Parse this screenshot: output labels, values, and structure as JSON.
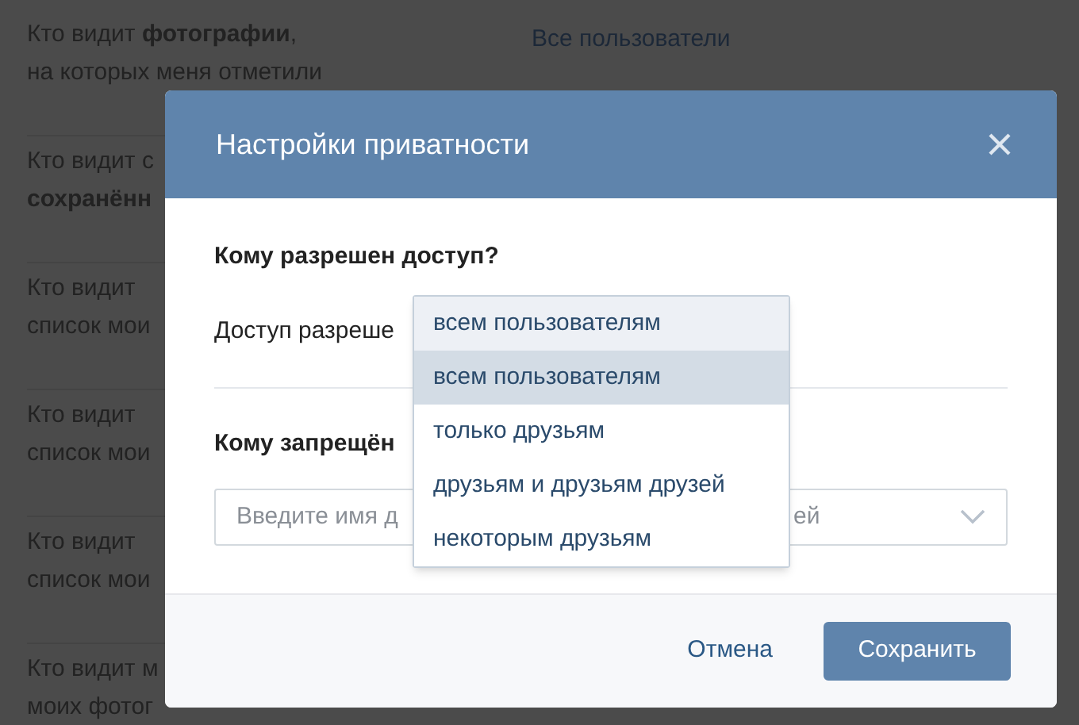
{
  "background": {
    "rows": [
      {
        "label": "Кто видит **фотографии**,\nна которых меня отметили",
        "value": "Все пользователи"
      },
      {
        "label": "Кто видит с\n**сохранённ**"
      },
      {
        "label": "Кто видит\nсписок мои"
      },
      {
        "label": "Кто видит\nсписок мои"
      },
      {
        "label": "Кто видит\nсписок мои"
      },
      {
        "label": "Кто видит м\nмоих фотог"
      }
    ]
  },
  "modal": {
    "title": "Настройки приватности",
    "allow_heading": "Кому разрешен доступ?",
    "allow_label": "Доступ разреше",
    "dropdown": {
      "value": "всем пользователям",
      "expanded": true,
      "options": [
        {
          "label": "всем пользователям",
          "selected": true
        },
        {
          "label": "только друзьям",
          "selected": false
        },
        {
          "label": "друзьям и друзьям друзей",
          "selected": false
        },
        {
          "label": "некоторым друзьям",
          "selected": false
        }
      ]
    },
    "deny_heading": "Кому запрещён",
    "deny_field": {
      "placeholder": "Введите имя д",
      "placeholder_tail": "ей"
    },
    "buttons": {
      "cancel": "Отмена",
      "save": "Сохранить"
    }
  }
}
